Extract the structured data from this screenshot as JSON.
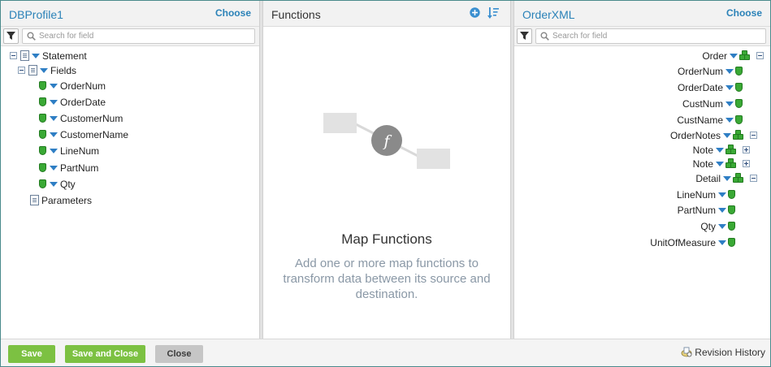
{
  "left_panel": {
    "title": "DBProfile1",
    "choose_label": "Choose",
    "search_placeholder": "Search for field",
    "tree": [
      {
        "label": "Statement",
        "level": 0
      },
      {
        "label": "Fields",
        "level": 1
      },
      {
        "label": "OrderNum",
        "level": 2
      },
      {
        "label": "OrderDate",
        "level": 2
      },
      {
        "label": "CustomerNum",
        "level": 2
      },
      {
        "label": "CustomerName",
        "level": 2
      },
      {
        "label": "LineNum",
        "level": 2
      },
      {
        "label": "PartNum",
        "level": 2
      },
      {
        "label": "Qty",
        "level": 2
      },
      {
        "label": "Parameters",
        "level": 1
      }
    ]
  },
  "middle_panel": {
    "title": "Functions",
    "function_glyph": "f",
    "empty_title": "Map Functions",
    "empty_description": "Add one or more map functions to transform data between its source and destination.",
    "icons": [
      "add-function-icon",
      "sort-icon"
    ]
  },
  "right_panel": {
    "title": "OrderXML",
    "choose_label": "Choose",
    "search_placeholder": "Search for field",
    "tree": [
      {
        "label": "Order",
        "kind": "group"
      },
      {
        "label": "OrderNum",
        "kind": "field"
      },
      {
        "label": "OrderDate",
        "kind": "field"
      },
      {
        "label": "CustNum",
        "kind": "field"
      },
      {
        "label": "CustName",
        "kind": "field"
      },
      {
        "label": "OrderNotes",
        "kind": "group"
      },
      {
        "label": "Note",
        "kind": "group-collapsed"
      },
      {
        "label": "Note",
        "kind": "group-collapsed"
      },
      {
        "label": "Detail",
        "kind": "group"
      },
      {
        "label": "LineNum",
        "kind": "field"
      },
      {
        "label": "PartNum",
        "kind": "field"
      },
      {
        "label": "Qty",
        "kind": "field"
      },
      {
        "label": "UnitOfMeasure",
        "kind": "field"
      }
    ]
  },
  "footer": {
    "save_label": "Save",
    "save_close_label": "Save and Close",
    "close_label": "Close",
    "revision_history_label": "Revision History"
  },
  "colors": {
    "accent_blue": "#2b82b8",
    "save_green": "#7cc142",
    "close_gray": "#c6c6c6",
    "field_green": "#3aa935",
    "frame_teal": "#4a8a8c"
  }
}
